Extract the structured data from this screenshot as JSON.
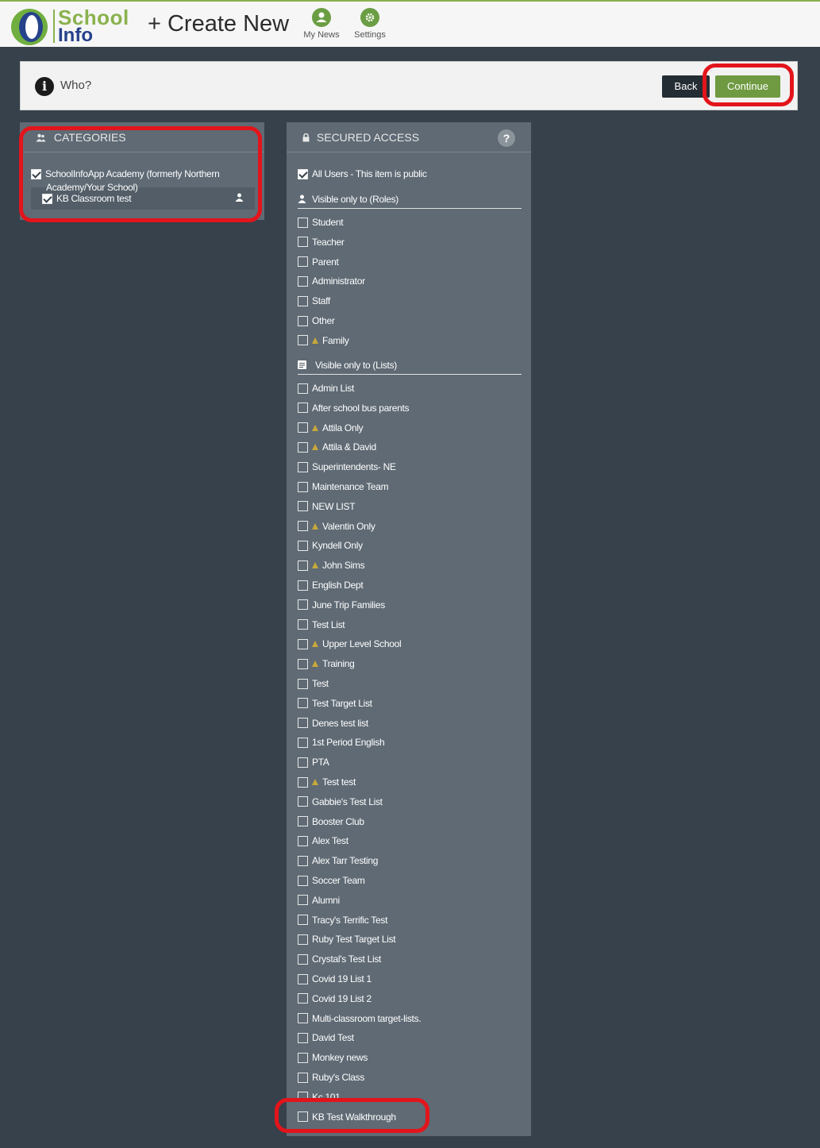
{
  "header": {
    "logo_school": "School",
    "logo_info": "Info",
    "create_new": "+ Create New",
    "nav": [
      {
        "label": "My News",
        "icon": "user-icon"
      },
      {
        "label": "Settings",
        "icon": "gear-icon"
      }
    ]
  },
  "who_bar": {
    "label": "Who?",
    "back_label": "Back",
    "continue_label": "Continue"
  },
  "categories": {
    "title": "CATEGORIES",
    "items": [
      {
        "label": "SchoolInfoApp Academy (formerly Northern",
        "label_cont": "Academy/Your School)",
        "checked": true
      },
      {
        "label": "KB Classroom test",
        "checked": true
      }
    ]
  },
  "secured_access": {
    "title": "SECURED ACCESS",
    "help": "?",
    "all_users": {
      "label": "All Users - This item is public",
      "checked": true
    },
    "roles_heading": "Visible only to (Roles)",
    "roles": [
      {
        "label": "Student",
        "warn": false
      },
      {
        "label": "Teacher",
        "warn": false
      },
      {
        "label": "Parent",
        "warn": false
      },
      {
        "label": "Administrator",
        "warn": false
      },
      {
        "label": "Staff",
        "warn": false
      },
      {
        "label": "Other",
        "warn": false
      },
      {
        "label": "Family",
        "warn": true
      }
    ],
    "lists_heading": "Visible only to (Lists)",
    "lists": [
      {
        "label": "Admin List",
        "warn": false
      },
      {
        "label": "After school bus parents",
        "warn": false
      },
      {
        "label": "Attila Only",
        "warn": true
      },
      {
        "label": "Attila & David",
        "warn": true
      },
      {
        "label": "Superintendents- NE",
        "warn": false
      },
      {
        "label": "Maintenance Team",
        "warn": false
      },
      {
        "label": "NEW LIST",
        "warn": false
      },
      {
        "label": "Valentin Only",
        "warn": true
      },
      {
        "label": "Kyndell Only",
        "warn": false
      },
      {
        "label": "John Sims",
        "warn": true
      },
      {
        "label": "English Dept",
        "warn": false
      },
      {
        "label": "June Trip Families",
        "warn": false
      },
      {
        "label": "Test List",
        "warn": false
      },
      {
        "label": "Upper Level School",
        "warn": true
      },
      {
        "label": "Training",
        "warn": true
      },
      {
        "label": "Test",
        "warn": false
      },
      {
        "label": "Test Target List",
        "warn": false
      },
      {
        "label": "Denes test list",
        "warn": false
      },
      {
        "label": "1st Period English",
        "warn": false
      },
      {
        "label": "PTA",
        "warn": false
      },
      {
        "label": "Test test",
        "warn": true
      },
      {
        "label": "Gabbie's Test List",
        "warn": false
      },
      {
        "label": "Booster Club",
        "warn": false
      },
      {
        "label": "Alex Test",
        "warn": false
      },
      {
        "label": "Alex Tarr Testing",
        "warn": false
      },
      {
        "label": "Soccer Team",
        "warn": false
      },
      {
        "label": "Alumni",
        "warn": false
      },
      {
        "label": "Tracy's Terrific Test",
        "warn": false
      },
      {
        "label": "Ruby Test Target List",
        "warn": false
      },
      {
        "label": "Crystal's Test List",
        "warn": false
      },
      {
        "label": "Covid 19 List 1",
        "warn": false
      },
      {
        "label": "Covid 19 List 2",
        "warn": false
      },
      {
        "label": "Multi-classroom target-lists.",
        "warn": false
      },
      {
        "label": "David Test",
        "warn": false
      },
      {
        "label": "Monkey news",
        "warn": false
      },
      {
        "label": "Ruby's Class",
        "warn": false
      },
      {
        "label": "Kc 101",
        "warn": false
      },
      {
        "label": "KB Test Walkthrough",
        "warn": false
      }
    ]
  },
  "colors": {
    "background": "#37414b",
    "panel": "#5f6a74",
    "accent_green": "#6f9a42",
    "highlight_red": "#e3141b",
    "warning": "#c7a83a"
  }
}
